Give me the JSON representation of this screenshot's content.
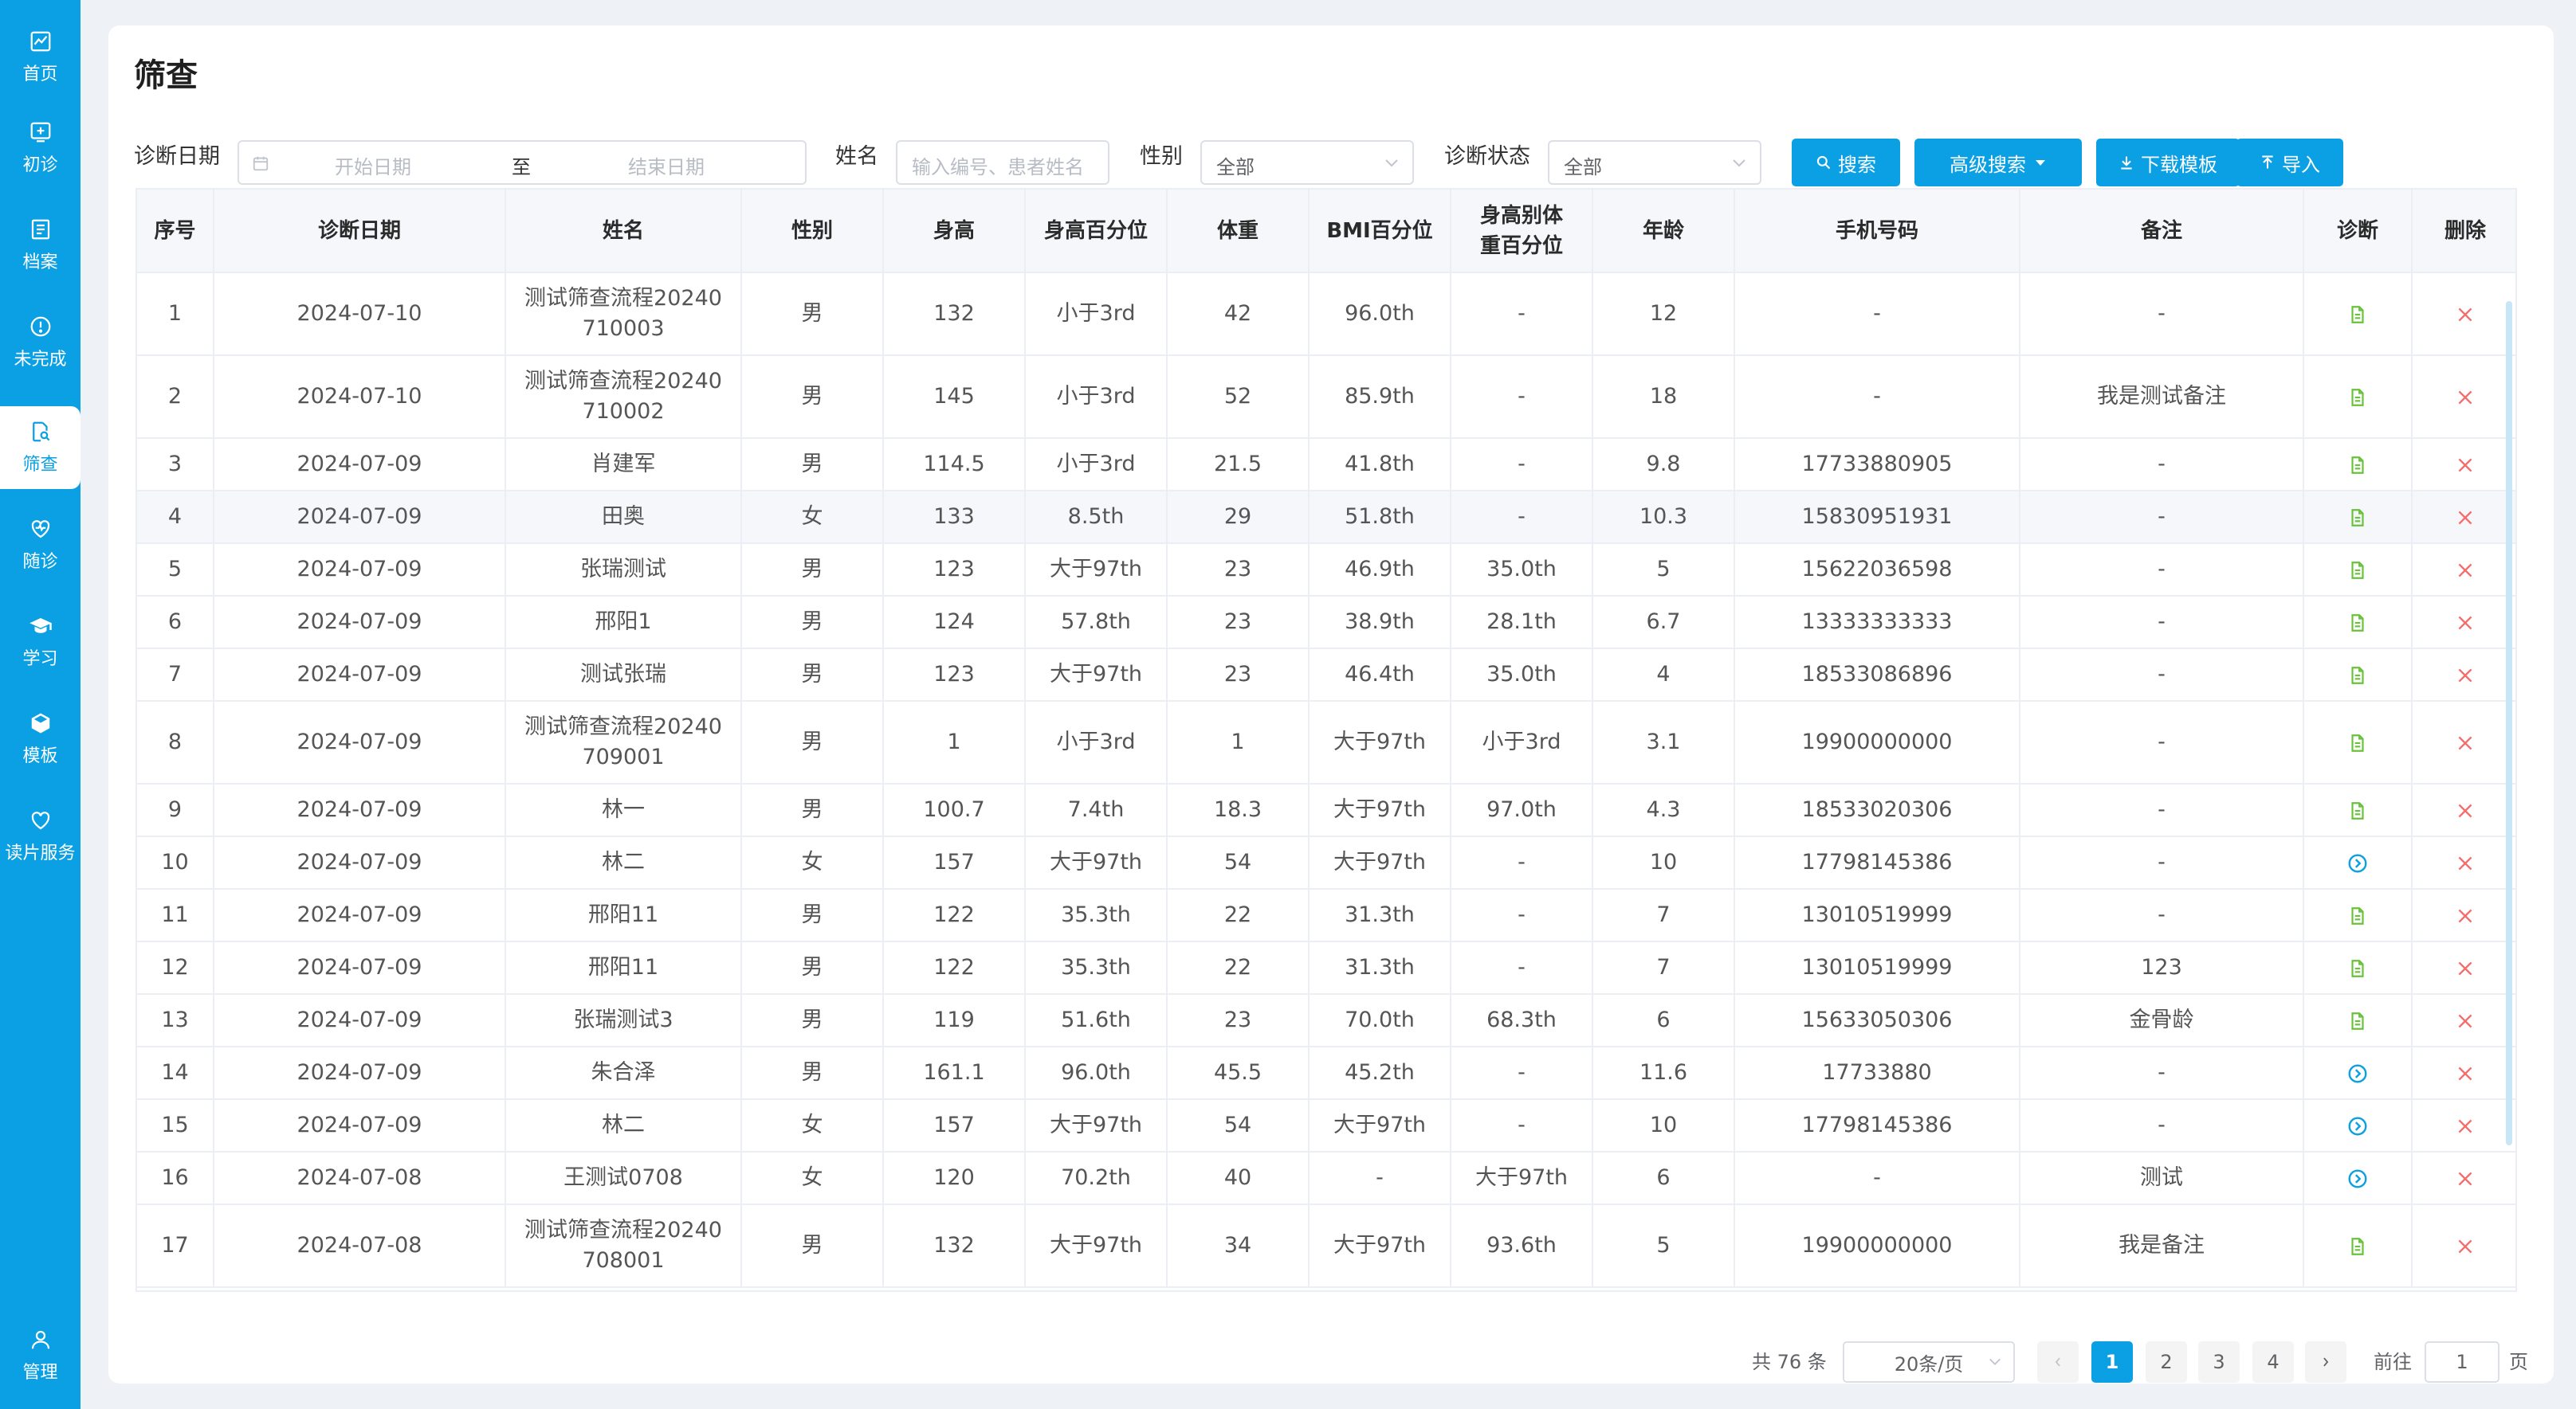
{
  "sidebar": {
    "items": [
      {
        "label": "首页",
        "icon": "chart-icon"
      },
      {
        "label": "初诊",
        "icon": "add-record-icon"
      },
      {
        "label": "档案",
        "icon": "archive-icon"
      },
      {
        "label": "未完成",
        "icon": "alert-circle-icon"
      },
      {
        "label": "筛查",
        "icon": "search-document-icon",
        "active": true
      },
      {
        "label": "随诊",
        "icon": "heart-pulse-icon"
      },
      {
        "label": "学习",
        "icon": "graduation-cap-icon"
      },
      {
        "label": "模板",
        "icon": "cube-icon"
      },
      {
        "label": "读片服务",
        "icon": "heart-icon"
      }
    ],
    "bottom": {
      "label": "管理",
      "icon": "user-icon"
    }
  },
  "page": {
    "title": "筛查"
  },
  "filters": {
    "date_label": "诊断日期",
    "date_start_placeholder": "开始日期",
    "date_separator": "至",
    "date_end_placeholder": "结束日期",
    "name_label": "姓名",
    "name_placeholder": "输入编号、患者姓名",
    "gender_label": "性别",
    "gender_value": "全部",
    "status_label": "诊断状态",
    "status_value": "全部"
  },
  "buttons": {
    "search": "搜索",
    "advanced": "高级搜索",
    "download": "下载模板",
    "import": "导入"
  },
  "table": {
    "columns": [
      "序号",
      "诊断日期",
      "姓名",
      "性别",
      "身高",
      "身高百分位",
      "体重",
      "BMI百分位",
      "身高别体重百分位",
      "年龄",
      "手机号码",
      "备注",
      "诊断",
      "删除"
    ],
    "rows": [
      {
        "no": "1",
        "date": "2024-07-10",
        "name": "测试筛查流程20240710003",
        "gender": "男",
        "height": "132",
        "height_pct": "小于3rd",
        "weight": "42",
        "bmi_pct": "96.0th",
        "wfh_pct": "-",
        "age": "12",
        "phone": "-",
        "note": "-",
        "diag": "report"
      },
      {
        "no": "2",
        "date": "2024-07-10",
        "name": "测试筛查流程20240710002",
        "gender": "男",
        "height": "145",
        "height_pct": "小于3rd",
        "weight": "52",
        "bmi_pct": "85.9th",
        "wfh_pct": "-",
        "age": "18",
        "phone": "-",
        "note": "我是测试备注",
        "diag": "report"
      },
      {
        "no": "3",
        "date": "2024-07-09",
        "name": "肖建军",
        "gender": "男",
        "height": "114.5",
        "height_pct": "小于3rd",
        "weight": "21.5",
        "bmi_pct": "41.8th",
        "wfh_pct": "-",
        "age": "9.8",
        "phone": "17733880905",
        "note": "-",
        "diag": "report"
      },
      {
        "no": "4",
        "date": "2024-07-09",
        "name": "田奥",
        "gender": "女",
        "height": "133",
        "height_pct": "8.5th",
        "weight": "29",
        "bmi_pct": "51.8th",
        "wfh_pct": "-",
        "age": "10.3",
        "phone": "15830951931",
        "note": "-",
        "diag": "report"
      },
      {
        "no": "5",
        "date": "2024-07-09",
        "name": "张瑞测试",
        "gender": "男",
        "height": "123",
        "height_pct": "大于97th",
        "weight": "23",
        "bmi_pct": "46.9th",
        "wfh_pct": "35.0th",
        "age": "5",
        "phone": "15622036598",
        "note": "-",
        "diag": "report"
      },
      {
        "no": "6",
        "date": "2024-07-09",
        "name": "邢阳1",
        "gender": "男",
        "height": "124",
        "height_pct": "57.8th",
        "weight": "23",
        "bmi_pct": "38.9th",
        "wfh_pct": "28.1th",
        "age": "6.7",
        "phone": "13333333333",
        "note": "-",
        "diag": "report"
      },
      {
        "no": "7",
        "date": "2024-07-09",
        "name": "测试张瑞",
        "gender": "男",
        "height": "123",
        "height_pct": "大于97th",
        "weight": "23",
        "bmi_pct": "46.4th",
        "wfh_pct": "35.0th",
        "age": "4",
        "phone": "18533086896",
        "note": "-",
        "diag": "report"
      },
      {
        "no": "8",
        "date": "2024-07-09",
        "name": "测试筛查流程20240709001",
        "gender": "男",
        "height": "1",
        "height_pct": "小于3rd",
        "weight": "1",
        "bmi_pct": "大于97th",
        "wfh_pct": "小于3rd",
        "age": "3.1",
        "phone": "19900000000",
        "note": "-",
        "diag": "report"
      },
      {
        "no": "9",
        "date": "2024-07-09",
        "name": "林一",
        "gender": "男",
        "height": "100.7",
        "height_pct": "7.4th",
        "weight": "18.3",
        "bmi_pct": "大于97th",
        "wfh_pct": "97.0th",
        "age": "4.3",
        "phone": "18533020306",
        "note": "-",
        "diag": "report"
      },
      {
        "no": "10",
        "date": "2024-07-09",
        "name": "林二",
        "gender": "女",
        "height": "157",
        "height_pct": "大于97th",
        "weight": "54",
        "bmi_pct": "大于97th",
        "wfh_pct": "-",
        "age": "10",
        "phone": "17798145386",
        "note": "-",
        "diag": "pending"
      },
      {
        "no": "11",
        "date": "2024-07-09",
        "name": "邢阳11",
        "gender": "男",
        "height": "122",
        "height_pct": "35.3th",
        "weight": "22",
        "bmi_pct": "31.3th",
        "wfh_pct": "-",
        "age": "7",
        "phone": "13010519999",
        "note": "-",
        "diag": "report"
      },
      {
        "no": "12",
        "date": "2024-07-09",
        "name": "邢阳11",
        "gender": "男",
        "height": "122",
        "height_pct": "35.3th",
        "weight": "22",
        "bmi_pct": "31.3th",
        "wfh_pct": "-",
        "age": "7",
        "phone": "13010519999",
        "note": "123",
        "diag": "report"
      },
      {
        "no": "13",
        "date": "2024-07-09",
        "name": "张瑞测试3",
        "gender": "男",
        "height": "119",
        "height_pct": "51.6th",
        "weight": "23",
        "bmi_pct": "70.0th",
        "wfh_pct": "68.3th",
        "age": "6",
        "phone": "15633050306",
        "note": "金骨龄",
        "diag": "report"
      },
      {
        "no": "14",
        "date": "2024-07-09",
        "name": "朱合泽",
        "gender": "男",
        "height": "161.1",
        "height_pct": "96.0th",
        "weight": "45.5",
        "bmi_pct": "45.2th",
        "wfh_pct": "-",
        "age": "11.6",
        "phone": "17733880",
        "note": "-",
        "diag": "pending"
      },
      {
        "no": "15",
        "date": "2024-07-09",
        "name": "林二",
        "gender": "女",
        "height": "157",
        "height_pct": "大于97th",
        "weight": "54",
        "bmi_pct": "大于97th",
        "wfh_pct": "-",
        "age": "10",
        "phone": "17798145386",
        "note": "-",
        "diag": "pending"
      },
      {
        "no": "16",
        "date": "2024-07-08",
        "name": "王测试0708",
        "gender": "女",
        "height": "120",
        "height_pct": "70.2th",
        "weight": "40",
        "bmi_pct": "-",
        "wfh_pct": "大于97th",
        "age": "6",
        "phone": "-",
        "note": "测试",
        "diag": "pending"
      },
      {
        "no": "17",
        "date": "2024-07-08",
        "name": "测试筛查流程20240708001",
        "gender": "男",
        "height": "132",
        "height_pct": "大于97th",
        "weight": "34",
        "bmi_pct": "大于97th",
        "wfh_pct": "93.6th",
        "age": "5",
        "phone": "19900000000",
        "note": "我是备注",
        "diag": "report"
      }
    ]
  },
  "pagination": {
    "total_text": "共 76 条",
    "page_size": "20条/页",
    "pages": [
      "1",
      "2",
      "3",
      "4"
    ],
    "current": "1",
    "goto_label": "前往",
    "goto_value": "1",
    "page_suffix": "页"
  },
  "colors": {
    "primary": "#0ba0e3",
    "report_icon": "#67c23a",
    "pending_icon": "#0ba0e3",
    "delete_icon": "#f56c6c"
  }
}
